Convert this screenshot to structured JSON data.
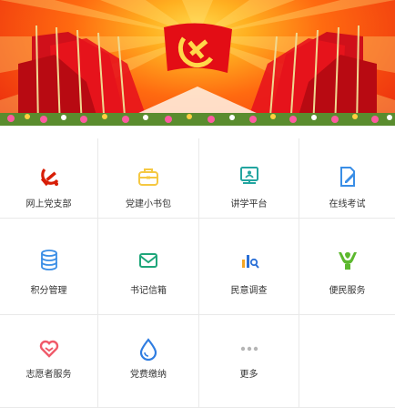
{
  "banner": {
    "emblem": "party-emblem-icon",
    "colors": {
      "red": "#e8200e",
      "gold": "#ffd84a"
    }
  },
  "menu": [
    {
      "label": "网上党支部",
      "icon": "party-emblem-icon",
      "color": "#d81e06"
    },
    {
      "label": "党建小书包",
      "icon": "briefcase-icon",
      "color": "#f5c842"
    },
    {
      "label": "讲学平台",
      "icon": "presentation-board-icon",
      "color": "#23a5a0"
    },
    {
      "label": "在线考试",
      "icon": "edit-document-icon",
      "color": "#3a8ee6"
    },
    {
      "label": "积分管理",
      "icon": "coin-stack-icon",
      "color": "#3a8ee6"
    },
    {
      "label": "书记信箱",
      "icon": "mail-icon",
      "color": "#1fa67a"
    },
    {
      "label": "民意调查",
      "icon": "survey-chart-icon",
      "color": "#2a6fd6"
    },
    {
      "label": "便民服务",
      "icon": "helping-hands-icon",
      "color": "#5cb82e"
    },
    {
      "label": "志愿者服务",
      "icon": "heart-icon",
      "color": "#f05a6a"
    },
    {
      "label": "党费缴纳",
      "icon": "water-drop-icon",
      "color": "#2f7de1"
    },
    {
      "label": "更多",
      "icon": "more-dots-icon",
      "color": "#b5b5b5"
    }
  ]
}
